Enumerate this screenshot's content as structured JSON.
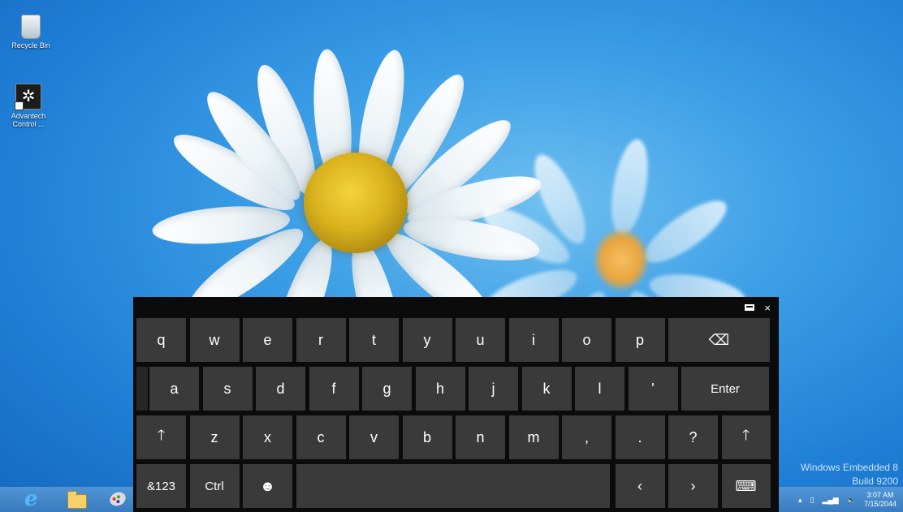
{
  "desktop": {
    "icons": [
      {
        "label": "Recycle Bin"
      },
      {
        "label": "Advantech Control ..."
      }
    ]
  },
  "keyboard": {
    "rows": [
      [
        "q",
        "w",
        "e",
        "r",
        "t",
        "y",
        "u",
        "i",
        "o",
        "p"
      ],
      [
        "a",
        "s",
        "d",
        "f",
        "g",
        "h",
        "j",
        "k",
        "l",
        "'"
      ],
      [
        "z",
        "x",
        "c",
        "v",
        "b",
        "n",
        "m",
        ",",
        ".",
        "?"
      ]
    ],
    "enter_label": "Enter",
    "backspace_symbol": "⌫",
    "shift_symbol": "🡑",
    "numbers_label": "&123",
    "ctrl_label": "Ctrl",
    "emoji_symbol": "☻",
    "left_arrow": "‹",
    "right_arrow": "›",
    "keyboard_symbol": "⌨",
    "close_symbol": "×"
  },
  "watermark": {
    "line1": "Windows Embedded 8",
    "line2": "Build 9200"
  },
  "tray": {
    "time": "3:07 AM",
    "date": "7/15/2044"
  }
}
